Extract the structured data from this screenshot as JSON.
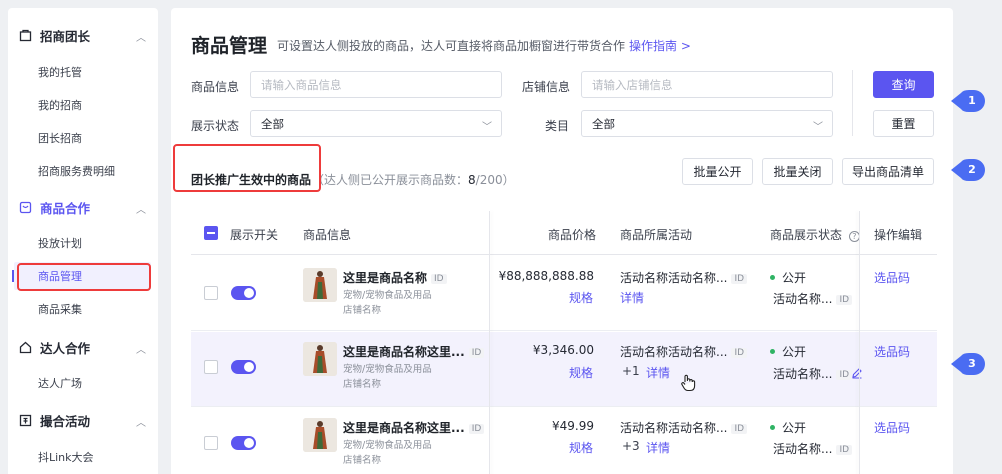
{
  "sidebar": {
    "groups": [
      {
        "label": "招商团长",
        "icon": "home-icon",
        "items": [
          "我的托管",
          "我的招商",
          "团长招商",
          "招商服务费明细"
        ]
      },
      {
        "label": "商品合作",
        "icon": "product-box-icon",
        "items": [
          "投放计划",
          "商品管理",
          "商品采集"
        ]
      },
      {
        "label": "达人合作",
        "icon": "house-icon",
        "items": [
          "达人广场"
        ]
      },
      {
        "label": "撮合活动",
        "icon": "activity-icon",
        "items": [
          "抖Link大会"
        ]
      }
    ],
    "selected_item": "商品管理"
  },
  "header": {
    "title": "商品管理",
    "description": "可设置达人侧投放的商品，达人可直接将商品加橱窗进行带货合作",
    "guide_link": "操作指南 >"
  },
  "filters": {
    "product_info_label": "商品信息",
    "product_info_placeholder": "请输入商品信息",
    "shop_info_label": "店铺信息",
    "shop_info_placeholder": "请输入店铺信息",
    "display_status_label": "展示状态",
    "display_status_value": "全部",
    "category_label": "类目",
    "category_value": "全部",
    "query_button": "查询",
    "reset_button": "重置"
  },
  "section": {
    "title": "团长推广生效中的商品",
    "subtitle_prefix": "（达人侧已公开展示商品数：",
    "count": "8",
    "total": "/200）"
  },
  "actions": {
    "batch_public": "批量公开",
    "batch_close": "批量关闭",
    "export": "导出商品清单"
  },
  "table": {
    "headers": {
      "toggle": "展示开关",
      "info": "商品信息",
      "price": "商品价格",
      "activity": "商品所属活动",
      "status": "商品展示状态",
      "ops": "操作编辑"
    },
    "rows": [
      {
        "name": "这里是商品名称",
        "id": "ID",
        "category": "宠物/宠物食品及用品",
        "shop": "店铺名称",
        "price": "¥88,888,888.88",
        "spec": "规格",
        "activity": "活动名称活动名称...",
        "activity_id": "ID",
        "extra": "",
        "detail": "详情",
        "status": "公开",
        "status_activity": "活动名称...",
        "status_id": "ID",
        "op": "选品码"
      },
      {
        "name": "这里是商品名称这里...",
        "id": "ID",
        "category": "宠物/宠物食品及用品",
        "shop": "店铺名称",
        "price": "¥3,346.00",
        "spec": "规格",
        "activity": "活动名称活动名称...",
        "activity_id": "ID",
        "extra": "+1",
        "detail": "详情",
        "status": "公开",
        "status_activity": "活动名称...",
        "status_id": "ID",
        "op": "选品码"
      },
      {
        "name": "这里是商品名称这里...",
        "id": "ID",
        "category": "宠物/宠物食品及用品",
        "shop": "店铺名称",
        "price": "¥49.99",
        "spec": "规格",
        "activity": "活动名称活动名称...",
        "activity_id": "ID",
        "extra": "+3",
        "detail": "详情",
        "status": "公开",
        "status_activity": "活动名称...",
        "status_id": "ID",
        "op": "选品码"
      }
    ]
  },
  "annotations": [
    "1",
    "2",
    "3"
  ],
  "colors": {
    "accent": "#5b55f0",
    "annotation_red": "#ee3b3b",
    "bubble_blue": "#4a6cf2",
    "status_green": "#2fb364"
  }
}
